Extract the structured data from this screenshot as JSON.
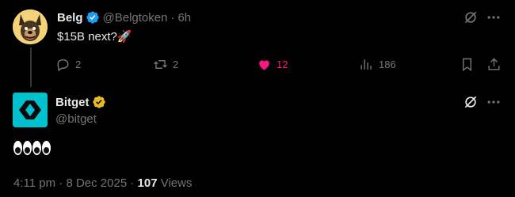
{
  "reply_tweet": {
    "display_name": "Belg",
    "handle": "@Belgtoken",
    "separator": "·",
    "time": "6h",
    "text": "$15B next?",
    "text_emoji": "🚀",
    "verified_color": "#1d9bf0",
    "avatar_icon": "dog-avatar",
    "actions": {
      "replies": "2",
      "reposts": "2",
      "likes": "12",
      "views": "186"
    },
    "like_color": "#f91880"
  },
  "main_tweet": {
    "display_name": "Bitget",
    "handle": "@bitget",
    "verified_color": "#e8b923",
    "avatar_color": "#00c2cf",
    "text_emoji": "👀👀",
    "time": "4:11 pm",
    "separator": "·",
    "date": "8 Dec 2025",
    "separator2": "·",
    "views_count": "107",
    "views_label": "Views"
  }
}
